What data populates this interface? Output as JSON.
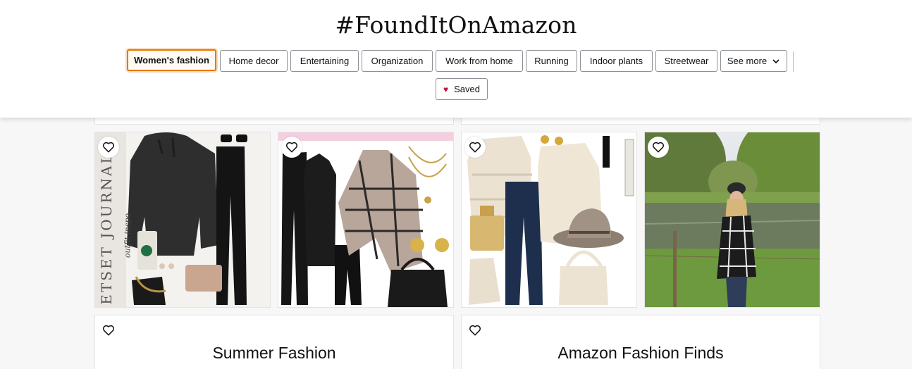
{
  "header": {
    "title": "#FoundItOnAmazon",
    "chips": [
      {
        "label": "Women's fashion",
        "active": true
      },
      {
        "label": "Home decor"
      },
      {
        "label": "Entertaining"
      },
      {
        "label": "Organization"
      },
      {
        "label": "Work from home"
      },
      {
        "label": "Running"
      },
      {
        "label": "Indoor plants"
      },
      {
        "label": "Streetwear"
      }
    ],
    "see_more_label": "See more",
    "saved_label": "Saved"
  },
  "collage_1": {
    "brand_text": "JETSET JOURNAL",
    "brand_subtext": "outfit inspo"
  },
  "cards": [
    {
      "title": "Summer Fashion"
    },
    {
      "title": "Amazon Fashion Finds"
    }
  ],
  "colors": {
    "accent": "#e77600",
    "heart": "#cc0c39",
    "border": "#8d9096"
  }
}
